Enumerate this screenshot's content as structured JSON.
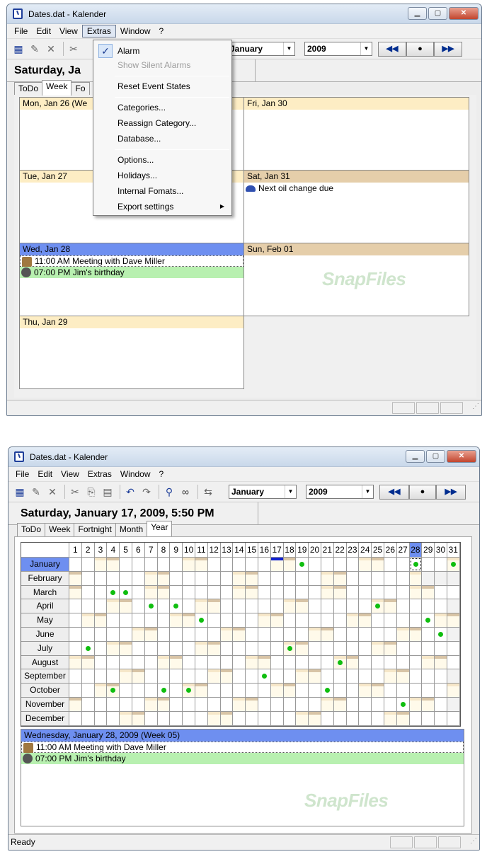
{
  "window1": {
    "title": "Dates.dat - Kalender",
    "menus": [
      "File",
      "Edit",
      "View",
      "Extras",
      "Window",
      "?"
    ],
    "month_select": "January",
    "year_select": "2009",
    "nav": {
      "prev": "◀◀",
      "today": "●",
      "next": "▶▶"
    },
    "date_heading": "Saturday, Ja",
    "tabs": [
      "ToDo",
      "Week",
      "Fo"
    ],
    "extras_menu": {
      "alarm": "Alarm",
      "show_silent": "Show Silent Alarms",
      "reset": "Reset Event States",
      "categories": "Categories...",
      "reassign": "Reassign Category...",
      "database": "Database...",
      "options": "Options...",
      "holidays": "Holidays...",
      "internal_formats": "Internal Fomats...",
      "export": "Export settings"
    },
    "days": {
      "mon": "Mon, Jan 26 (We",
      "tue": "Tue, Jan 27",
      "wed": "Wed, Jan 28",
      "thu": "Thu, Jan 29",
      "fri": "Fri, Jan 30",
      "sat": "Sat, Jan 31",
      "sun": "Sun, Feb 01"
    },
    "events": {
      "oil": "Next oil change due",
      "meeting": "11:00 AM Meeting with Dave Miller",
      "birthday": "07:00 PM Jim's birthday"
    },
    "watermark": "SnapFiles",
    "status": ""
  },
  "window2": {
    "title": "Dates.dat - Kalender",
    "menus": [
      "File",
      "Edit",
      "View",
      "Extras",
      "Window",
      "?"
    ],
    "month_select": "January",
    "year_select": "2009",
    "nav": {
      "prev": "◀◀",
      "today": "●",
      "next": "▶▶"
    },
    "date_heading": "Saturday, January 17, 2009, 5:50 PM",
    "tabs": [
      "ToDo",
      "Week",
      "Fortnight",
      "Month",
      "Year"
    ],
    "months": [
      "January",
      "February",
      "March",
      "April",
      "May",
      "June",
      "July",
      "August",
      "September",
      "October",
      "November",
      "December"
    ],
    "day_numbers": [
      "1",
      "2",
      "3",
      "4",
      "5",
      "6",
      "7",
      "8",
      "9",
      "10",
      "11",
      "12",
      "13",
      "14",
      "15",
      "16",
      "17",
      "18",
      "19",
      "20",
      "21",
      "22",
      "23",
      "24",
      "25",
      "26",
      "27",
      "28",
      "29",
      "30",
      "31"
    ],
    "detail_header": "Wednesday, January 28, 2009 (Week 05)",
    "events": {
      "meeting": "11:00 AM Meeting with Dave Miller",
      "birthday": "07:00 PM Jim's birthday"
    },
    "watermark": "SnapFiles",
    "status": "Ready"
  },
  "colors": {
    "accent": "#6e8ff0",
    "weekend": "#e5ceaa",
    "event_green": "#0fbe0f",
    "birthday_bg": "#b8f0b0",
    "header_tan": "#fdedc4"
  }
}
